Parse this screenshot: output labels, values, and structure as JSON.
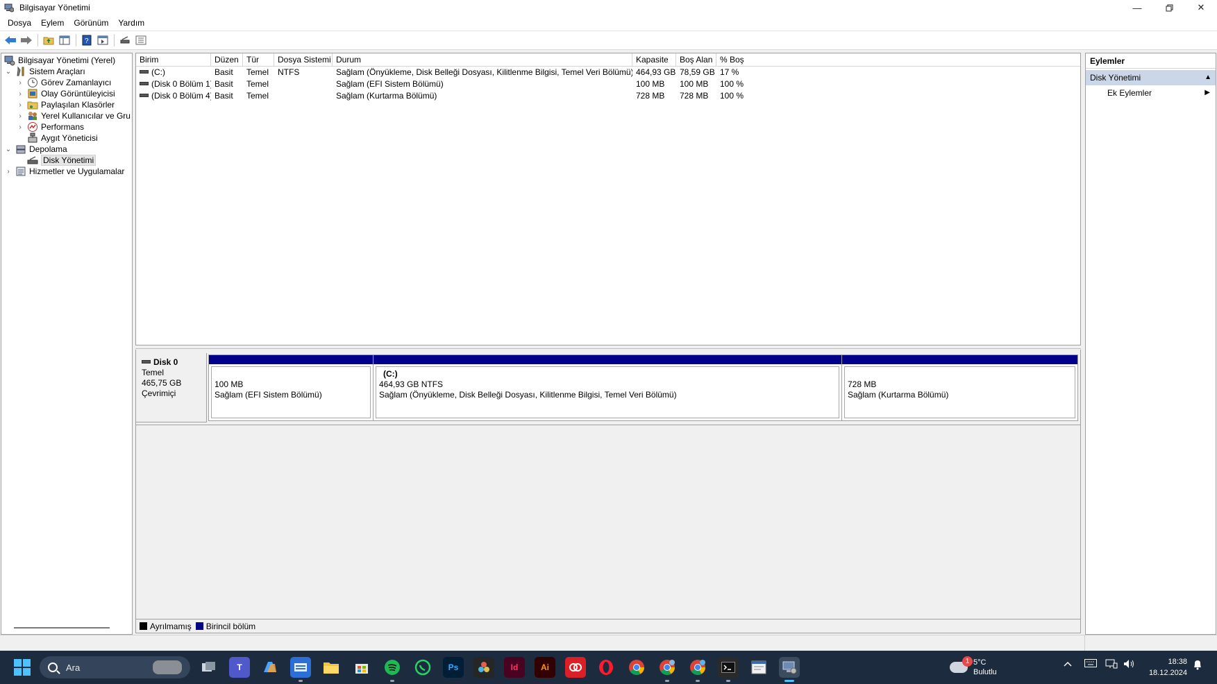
{
  "window": {
    "title": "Bilgisayar Yönetimi"
  },
  "menu": [
    "Dosya",
    "Eylem",
    "Görünüm",
    "Yardım"
  ],
  "tree": [
    {
      "label": "Bilgisayar Yönetimi (Yerel)",
      "level": 0,
      "expander": "",
      "icon": "computer-management-icon"
    },
    {
      "label": "Sistem Araçları",
      "level": 1,
      "expander": "∨",
      "icon": "system-tools-icon"
    },
    {
      "label": "Görev Zamanlayıcı",
      "level": 2,
      "expander": "›",
      "icon": "clock-icon"
    },
    {
      "label": "Olay Görüntüleyicisi",
      "level": 2,
      "expander": "›",
      "icon": "event-viewer-icon"
    },
    {
      "label": "Paylaşılan Klasörler",
      "level": 2,
      "expander": "›",
      "icon": "shared-folder-icon"
    },
    {
      "label": "Yerel Kullanıcılar ve Gru",
      "level": 2,
      "expander": "›",
      "icon": "users-icon"
    },
    {
      "label": "Performans",
      "level": 2,
      "expander": "›",
      "icon": "performance-icon"
    },
    {
      "label": "Aygıt Yöneticisi",
      "level": 2,
      "expander": "",
      "icon": "device-manager-icon"
    },
    {
      "label": "Depolama",
      "level": 1,
      "expander": "∨",
      "icon": "storage-icon"
    },
    {
      "label": "Disk Yönetimi",
      "level": 2,
      "expander": "",
      "icon": "disk-management-icon",
      "selected": true
    },
    {
      "label": "Hizmetler ve Uygulamalar",
      "level": 1,
      "expander": "›",
      "icon": "services-icon"
    }
  ],
  "volumes": {
    "columns": [
      "Birim",
      "Düzen",
      "Tür",
      "Dosya Sistemi",
      "Durum",
      "Kapasite",
      "Boş Alan",
      "% Boş"
    ],
    "rows": [
      [
        "(C:)",
        "Basit",
        "Temel",
        "NTFS",
        "Sağlam (Önyükleme, Disk Belleği Dosyası, Kilitlenme Bilgisi, Temel Veri Bölümü)",
        "464,93 GB",
        "78,59 GB",
        "17 %"
      ],
      [
        "(Disk 0 Bölüm 1)",
        "Basit",
        "Temel",
        "",
        "Sağlam (EFI Sistem Bölümü)",
        "100 MB",
        "100 MB",
        "100 %"
      ],
      [
        "(Disk 0 Bölüm 4)",
        "Basit",
        "Temel",
        "",
        "Sağlam (Kurtarma Bölümü)",
        "728 MB",
        "728 MB",
        "100 %"
      ]
    ]
  },
  "disk": {
    "name": "Disk 0",
    "type": "Temel",
    "size": "465,75 GB",
    "status": "Çevrimiçi",
    "partitions": [
      {
        "name": "",
        "size": "100 MB",
        "status": "Sağlam (EFI Sistem Bölümü)"
      },
      {
        "name": "(C:)",
        "size": "464,93 GB NTFS",
        "status": "Sağlam (Önyükleme, Disk Belleği Dosyası, Kilitlenme Bilgisi, Temel Veri Bölümü)"
      },
      {
        "name": "",
        "size": "728 MB",
        "status": "Sağlam (Kurtarma Bölümü)"
      }
    ]
  },
  "legend": [
    {
      "label": "Ayrılmamış",
      "color": "#000000"
    },
    {
      "label": "Birincil bölüm",
      "color": "#00008b"
    }
  ],
  "actions": {
    "header": "Eylemler",
    "section": "Disk Yönetimi",
    "items": [
      "Ek Eylemler"
    ]
  },
  "taskbar": {
    "search_placeholder": "Ara",
    "apps": [
      "task-view",
      "teams",
      "copilot",
      "keyboard-app",
      "file-explorer",
      "microsoft-store",
      "spotify",
      "whatsapp",
      "photoshop",
      "davinci",
      "indesign",
      "illustrator",
      "creative-cloud",
      "opera",
      "chrome",
      "chrome-profile-2",
      "chrome-profile-3",
      "terminal",
      "notepad",
      "computer-management"
    ],
    "app_labels": {
      "photoshop": "Ps",
      "indesign": "Id",
      "illustrator": "Ai"
    },
    "weather_temp": "5°C",
    "weather_desc": "Bulutlu",
    "weather_badge": "1",
    "time": "18:38",
    "date": "18.12.2024"
  }
}
